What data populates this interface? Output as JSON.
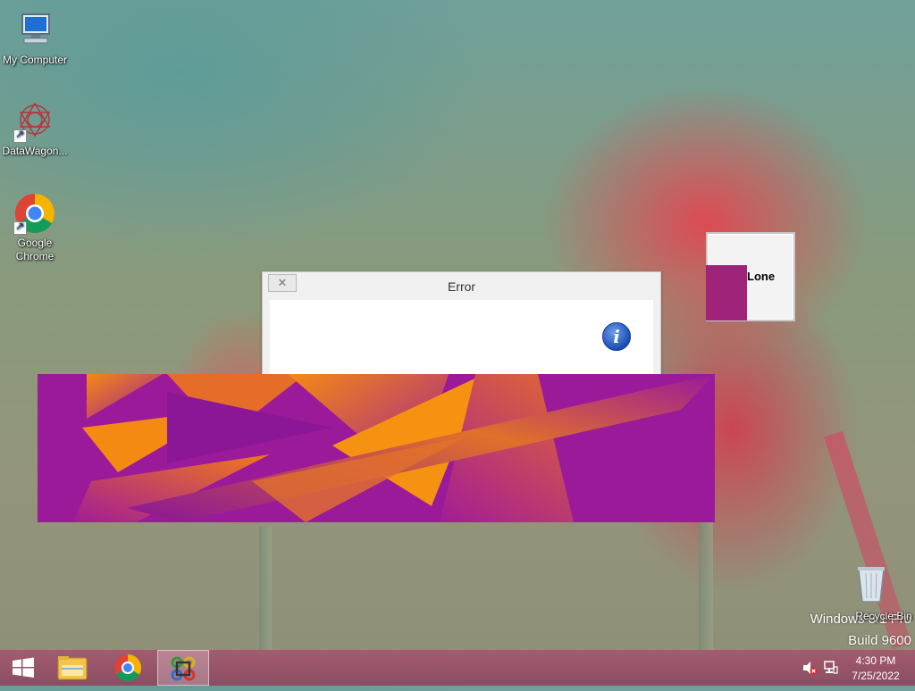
{
  "desktop": {
    "icons": [
      {
        "label": "My Computer",
        "icon": "computer-icon"
      },
      {
        "label": "DataWagon...",
        "icon": "datawagon-icon"
      },
      {
        "label_line1": "Google",
        "label_line2": "Chrome",
        "icon": "chrome-icon"
      },
      {
        "label": "Recycle Bin",
        "icon": "recycle-bin-icon"
      }
    ],
    "watermark": {
      "line1": "Windows 8.1 Pro",
      "line2": "Build 9600"
    }
  },
  "error_dialog": {
    "title": "Error",
    "close_glyph": "✕",
    "icon": "info-icon",
    "icon_glyph": "i"
  },
  "lone_window": {
    "label": "Lone",
    "accent": "#a0237a"
  },
  "taskbar": {
    "items": [
      {
        "icon": "windows-start-icon"
      },
      {
        "icon": "file-explorer-icon"
      },
      {
        "icon": "chrome-icon"
      },
      {
        "icon": "command-app-icon",
        "active": true
      }
    ],
    "tray": {
      "volume_icon": "volume-muted-icon",
      "network_icon": "network-icon",
      "time": "4:30 PM",
      "date": "7/25/2022"
    }
  },
  "colors": {
    "banner_purple": "#9b1a9a",
    "banner_orange": "#f07a1a",
    "taskbar": "#9a5468"
  }
}
